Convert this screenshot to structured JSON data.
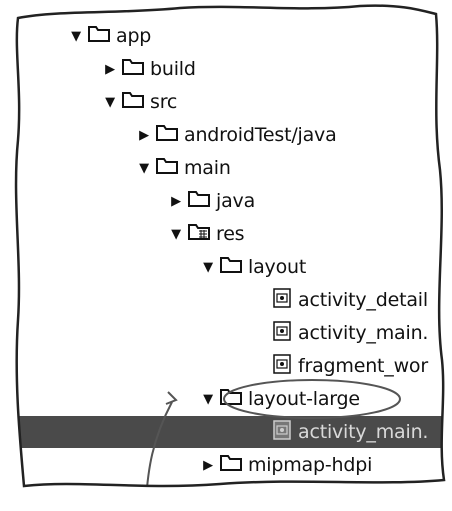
{
  "tree": {
    "rows": [
      {
        "label": "app",
        "expanded": true,
        "kind": "folder"
      },
      {
        "label": "build",
        "expanded": false,
        "kind": "folder"
      },
      {
        "label": "src",
        "expanded": true,
        "kind": "folder"
      },
      {
        "label": "androidTest/java",
        "expanded": false,
        "kind": "folder"
      },
      {
        "label": "main",
        "expanded": true,
        "kind": "folder"
      },
      {
        "label": "java",
        "expanded": false,
        "kind": "folder"
      },
      {
        "label": "res",
        "expanded": true,
        "kind": "res-folder"
      },
      {
        "label": "layout",
        "expanded": true,
        "kind": "folder"
      },
      {
        "label": "activity_detail",
        "kind": "layout-file"
      },
      {
        "label": "activity_main.",
        "kind": "layout-file"
      },
      {
        "label": "fragment_wor",
        "kind": "layout-file"
      },
      {
        "label": "layout-large",
        "expanded": true,
        "kind": "folder"
      },
      {
        "label": "activity_main.",
        "kind": "layout-file",
        "selected": true
      },
      {
        "label": "mipmap-hdpi",
        "expanded": false,
        "kind": "folder"
      }
    ]
  },
  "colors": {
    "selection": "#4a4a4a",
    "text": "#111111",
    "selected_text": "#d9d9d9"
  }
}
